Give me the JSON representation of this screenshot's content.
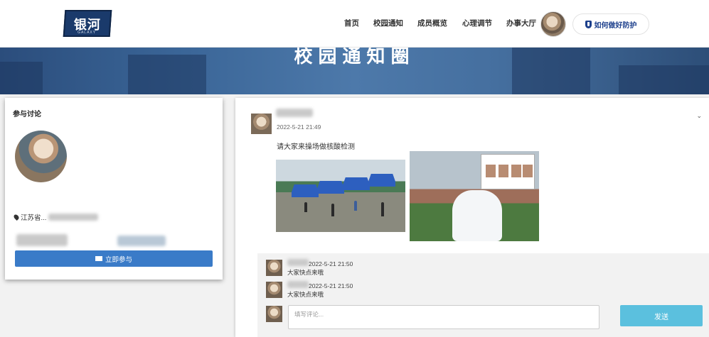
{
  "nav": {
    "logo_text": "银河",
    "logo_sub": "GALAXY",
    "menu": [
      "首页",
      "校园通知",
      "成员概览",
      "心理调节",
      "办事大厅"
    ],
    "protect_button": "如何做好防护"
  },
  "banner": {
    "title": "校园通知圈"
  },
  "participate": {
    "title": "参与讨论",
    "location": "江苏省...",
    "join_button": "立即参与"
  },
  "post": {
    "time": "2022-5-21 21:49",
    "content": "请大家来操场做核酸检测",
    "comments": [
      {
        "time": "2022-5-21 21:50",
        "text": "大家快点来哦"
      },
      {
        "time": "2022-5-21 21:50",
        "text": "大家快点来哦"
      }
    ],
    "comment_placeholder": "填写评论...",
    "send_button": "发送"
  },
  "colors": {
    "primary": "#3a7bc8",
    "send": "#5bc0de",
    "navy": "#1a3a6b"
  }
}
